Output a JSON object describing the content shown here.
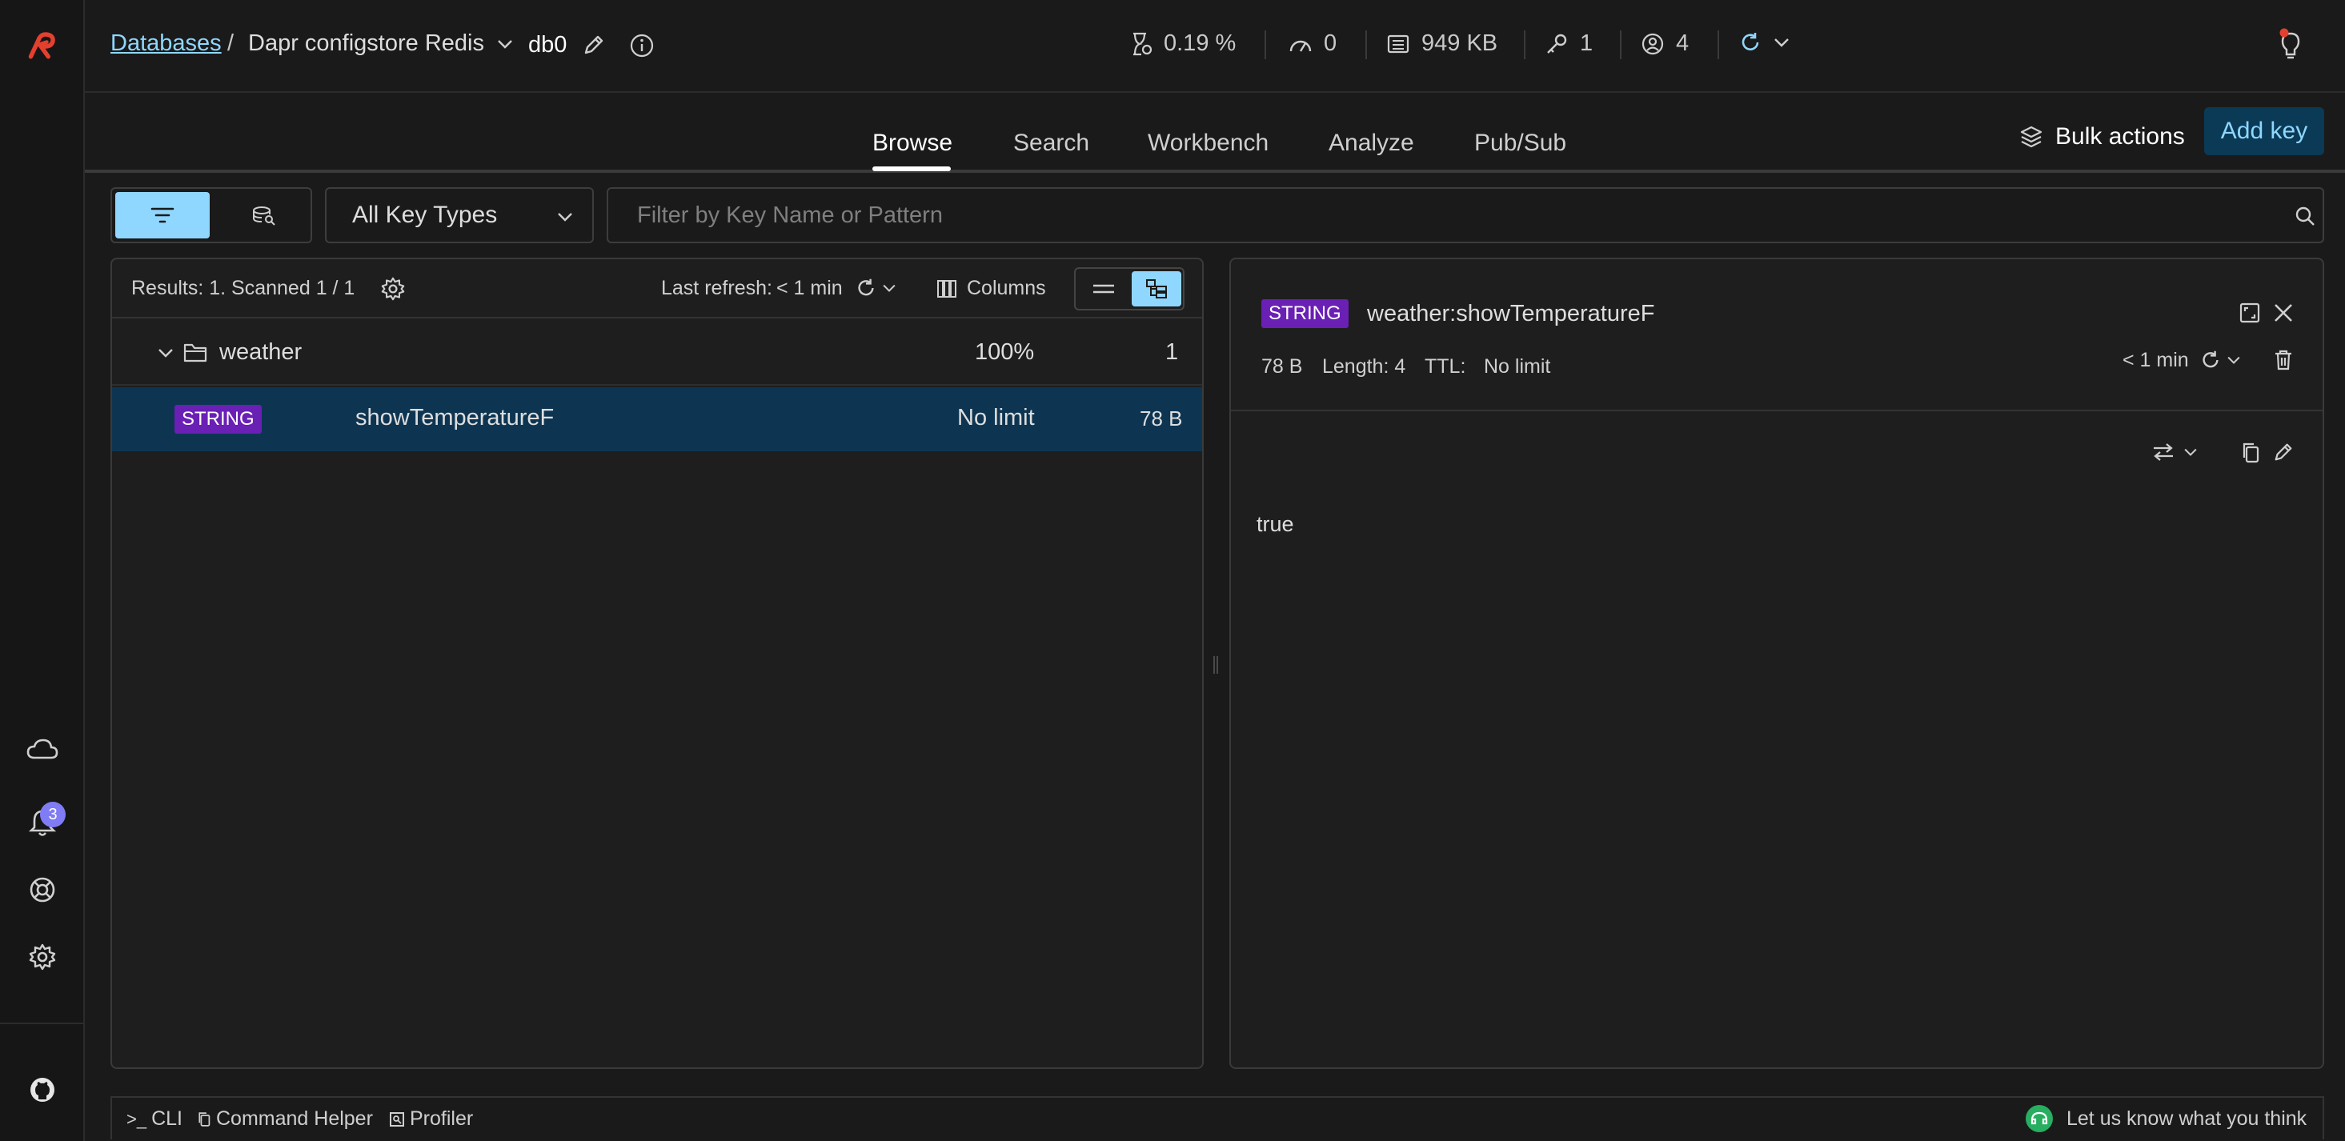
{
  "sidebar": {
    "logo": "redis-logo-icon",
    "notification_count": "3",
    "icons": [
      "cloud-icon",
      "bell-icon",
      "help-lifebuoy-icon",
      "gear-icon",
      "github-icon"
    ]
  },
  "header": {
    "breadcrumb_link": "Databases",
    "breadcrumb_sep": "/",
    "database_name": "Dapr configstore Redis",
    "db_index": "db0",
    "stats": {
      "cpu": "0.19 %",
      "ops": "0",
      "memory": "949 KB",
      "keys": "1",
      "clients": "4"
    }
  },
  "tabs": [
    {
      "label": "Browse",
      "active": true
    },
    {
      "label": "Search",
      "active": false
    },
    {
      "label": "Workbench",
      "active": false
    },
    {
      "label": "Analyze",
      "active": false
    },
    {
      "label": "Pub/Sub",
      "active": false
    }
  ],
  "actions": {
    "bulk_actions": "Bulk actions",
    "add_key": "Add key"
  },
  "filter": {
    "key_type": "All Key Types",
    "search_placeholder": "Filter by Key Name or Pattern"
  },
  "list": {
    "results": "Results: 1. Scanned 1 / 1",
    "last_refresh_label": "Last refresh:",
    "last_refresh_value": "< 1 min",
    "columns_label": "Columns",
    "folder": {
      "name": "weather",
      "percent": "100%",
      "count": "1"
    },
    "key": {
      "type": "STRING",
      "name": "showTemperatureF",
      "ttl": "No limit",
      "size": "78 B"
    }
  },
  "detail": {
    "type": "STRING",
    "key_name": "weather:showTemperatureF",
    "size": "78 B",
    "length": "Length: 4",
    "ttl_label": "TTL:",
    "ttl_value": "No limit",
    "refresh": "< 1 min",
    "value": "true"
  },
  "bottom_bar": {
    "cli": "CLI",
    "command_helper": "Command Helper",
    "profiler": "Profiler",
    "feedback": "Let us know what you think"
  },
  "colors": {
    "accent": "#8fd7ff",
    "string_badge": "#6a1fb5",
    "selected_row": "#0d3552",
    "logo_red": "#e4402f",
    "notification_badge": "#7f7cf5"
  }
}
